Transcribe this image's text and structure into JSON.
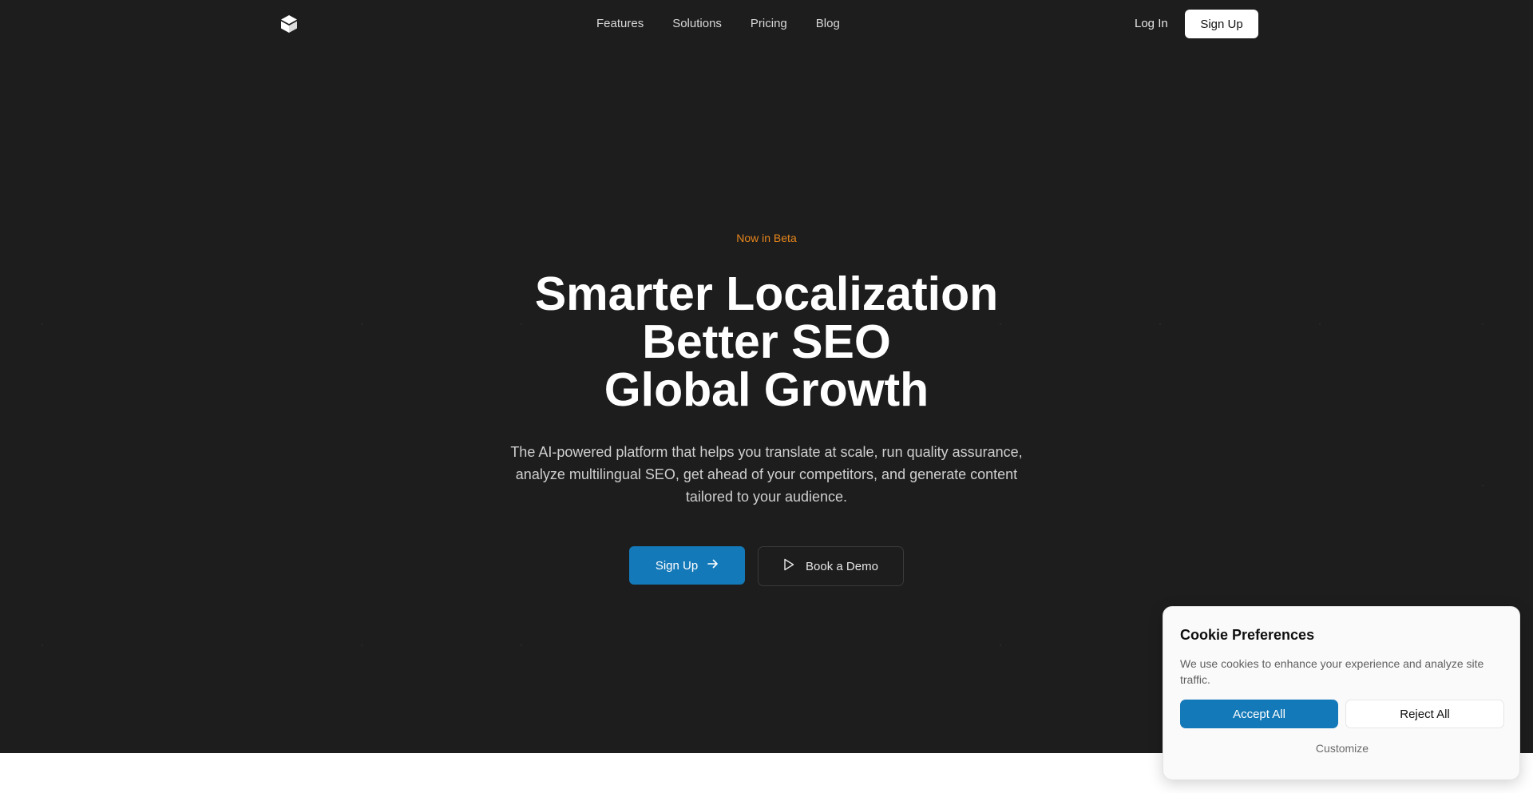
{
  "nav": {
    "logo_icon": "cube-logo-icon",
    "links": [
      "Features",
      "Solutions",
      "Pricing",
      "Blog"
    ],
    "login_label": "Log In",
    "signup_label": "Sign Up"
  },
  "hero": {
    "badge": "Now in Beta",
    "headline": [
      "Smarter Localization",
      "Better SEO",
      "Global Growth"
    ],
    "subtext": "The AI-powered platform that helps you translate at scale, run quality assurance, analyze multilingual SEO, get ahead of your competitors, and generate content tailored to your audience.",
    "primary_cta": "Sign Up",
    "primary_cta_icon": "arrow-right-icon",
    "secondary_cta": "Book a Demo",
    "secondary_cta_icon": "play-icon"
  },
  "cookie": {
    "title": "Cookie Preferences",
    "text": "We use cookies to enhance your experience and analyze site traffic.",
    "accept_label": "Accept All",
    "reject_label": "Reject All",
    "customize_label": "Customize"
  },
  "colors": {
    "background": "#1d1d1d",
    "accent": "#1479b8",
    "badge": "#e8861c"
  }
}
